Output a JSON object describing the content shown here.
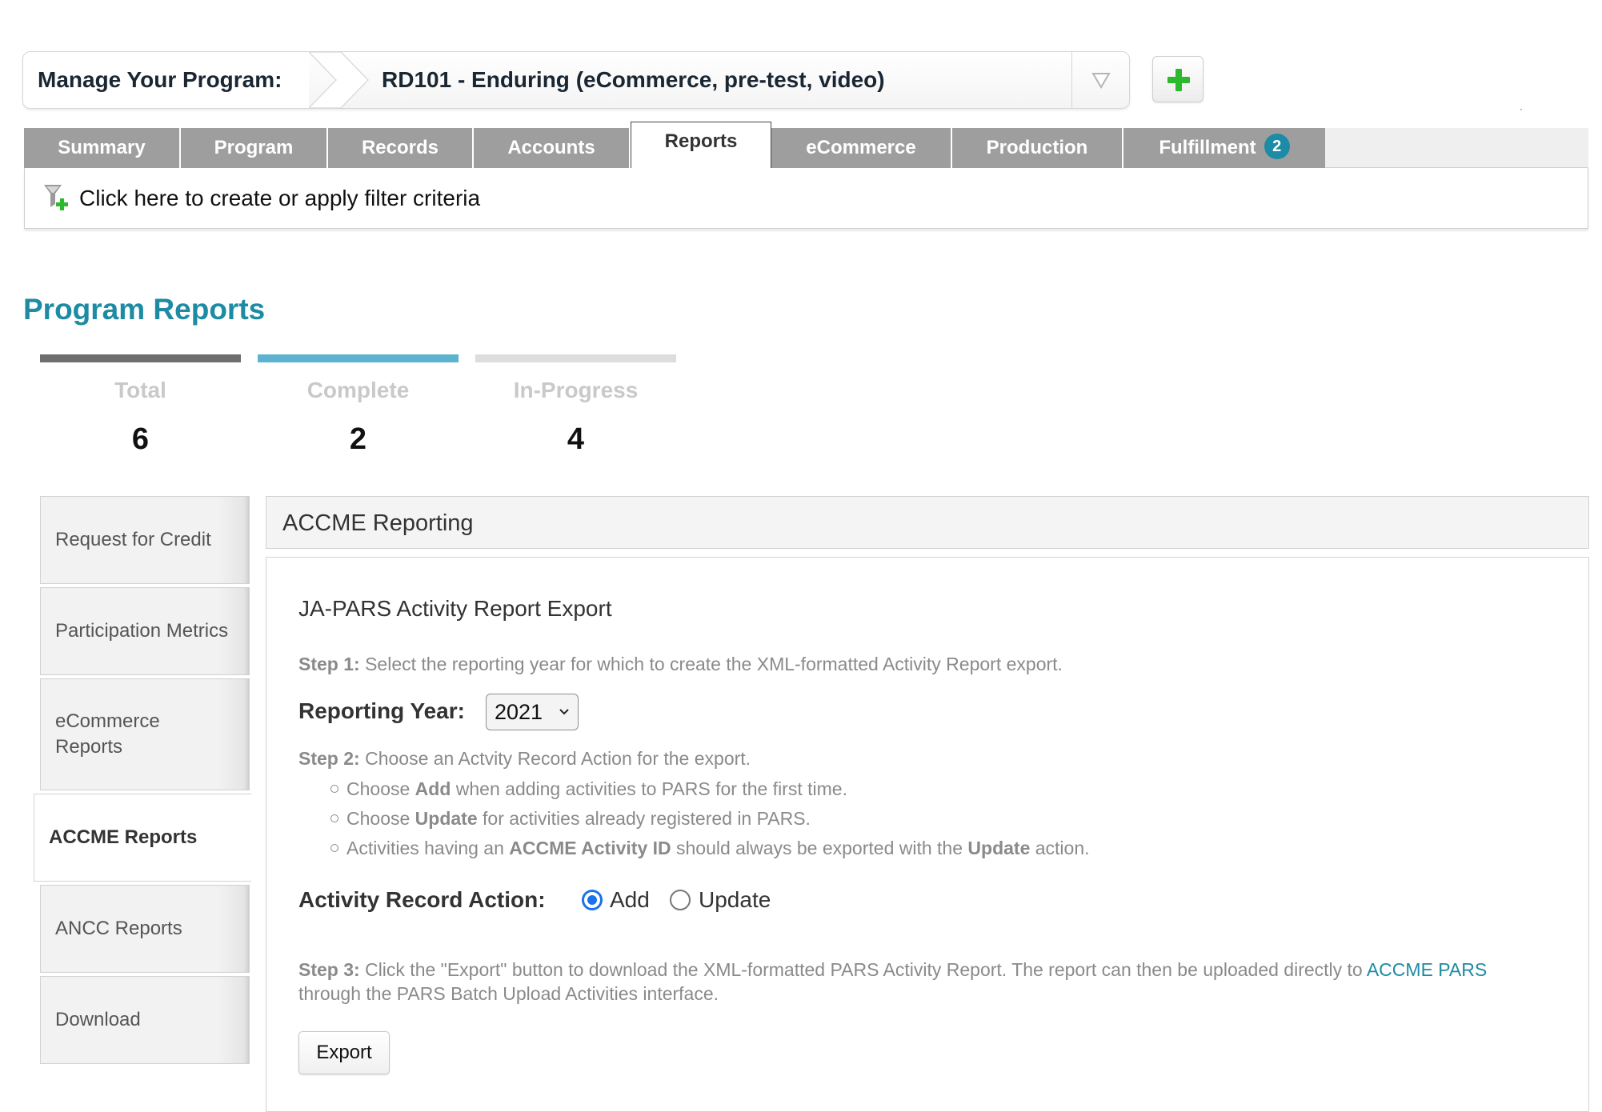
{
  "program_selector": {
    "label": "Manage Your Program:",
    "value": "RD101 - Enduring (eCommerce, pre-test, video)"
  },
  "tabs": [
    {
      "label": "Summary"
    },
    {
      "label": "Program"
    },
    {
      "label": "Records"
    },
    {
      "label": "Accounts"
    },
    {
      "label": "Reports",
      "active": true
    },
    {
      "label": "eCommerce"
    },
    {
      "label": "Production"
    },
    {
      "label": "Fulfillment",
      "badge": "2"
    }
  ],
  "filter": {
    "text": "Click here to create or apply filter criteria"
  },
  "page": {
    "title": "Program Reports",
    "stats": [
      {
        "label": "Total",
        "value": "6",
        "color": "#6e6e6e"
      },
      {
        "label": "Complete",
        "value": "2",
        "color": "#5bb3cf"
      },
      {
        "label": "In-Progress",
        "value": "4",
        "color": "#dddddd"
      }
    ]
  },
  "sidebar": {
    "items": [
      {
        "label": "Request for Credit"
      },
      {
        "label": "Participation Metrics"
      },
      {
        "label": "eCommerce Reports"
      },
      {
        "label": "ACCME Reports",
        "active": true
      },
      {
        "label": "ANCC Reports"
      },
      {
        "label": "Download"
      }
    ]
  },
  "panel": {
    "header": "ACCME Reporting",
    "section_title": "JA-PARS Activity Report Export",
    "step1_prefix": "Step 1:",
    "step1_text": "Select the reporting year for which to create the XML-formatted Activity Report export.",
    "reporting_year_label": "Reporting Year:",
    "reporting_year_value": "2021",
    "step2_prefix": "Step 2:",
    "step2_text": "Choose an Actvity Record Action for the export.",
    "bullets": {
      "b1_pre": "Choose ",
      "b1_bold": "Add",
      "b1_post": " when adding activities to PARS for the first time.",
      "b2_pre": "Choose ",
      "b2_bold": "Update",
      "b2_post": " for activities already registered in PARS.",
      "b3_pre": "Activities having an ",
      "b3_bold": "ACCME Activity ID",
      "b3_mid": " should always be exported with the ",
      "b3_bold2": "Update",
      "b3_post": " action."
    },
    "action_label": "Activity Record Action:",
    "radio_add": "Add",
    "radio_update": "Update",
    "selected_action": "Add",
    "step3_prefix": "Step 3:",
    "step3_text": "Click the \"Export\" button to download the XML-formatted PARS Activity Report. The report can then be uploaded directly to",
    "step3_link": "ACCME PARS",
    "step3_text2": "through the PARS Batch Upload Activities interface.",
    "export_label": "Export"
  },
  "colors": {
    "accent": "#1d8ba3",
    "tab_inactive": "#9e9e9e",
    "add_icon": "#2eb82e"
  }
}
